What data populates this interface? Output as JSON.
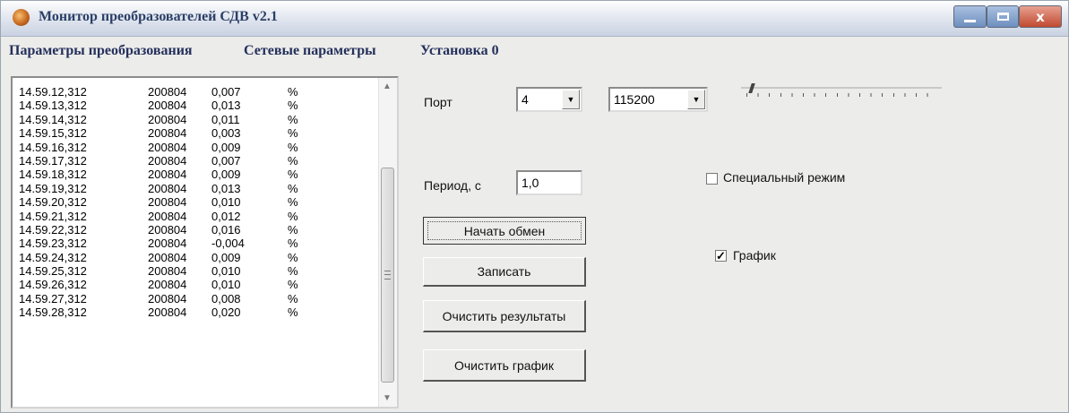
{
  "window": {
    "title": "Монитор преобразователей СДВ v2.1",
    "close_glyph": "x"
  },
  "menu": [
    "Параметры преобразования",
    "Сетевые параметры",
    "Установка 0"
  ],
  "log": {
    "rows": [
      {
        "time": "14.59.12,312",
        "code": "200804",
        "value": "0,007",
        "unit": "%"
      },
      {
        "time": "14.59.13,312",
        "code": "200804",
        "value": "0,013",
        "unit": "%"
      },
      {
        "time": "14.59.14,312",
        "code": "200804",
        "value": "0,011",
        "unit": "%"
      },
      {
        "time": "14.59.15,312",
        "code": "200804",
        "value": "0,003",
        "unit": "%"
      },
      {
        "time": "14.59.16,312",
        "code": "200804",
        "value": "0,009",
        "unit": "%"
      },
      {
        "time": "14.59.17,312",
        "code": "200804",
        "value": "0,007",
        "unit": "%"
      },
      {
        "time": "14.59.18,312",
        "code": "200804",
        "value": "0,009",
        "unit": "%"
      },
      {
        "time": "14.59.19,312",
        "code": "200804",
        "value": "0,013",
        "unit": "%"
      },
      {
        "time": "14.59.20,312",
        "code": "200804",
        "value": "0,010",
        "unit": "%"
      },
      {
        "time": "14.59.21,312",
        "code": "200804",
        "value": "0,012",
        "unit": "%"
      },
      {
        "time": "14.59.22,312",
        "code": "200804",
        "value": "0,016",
        "unit": "%"
      },
      {
        "time": "14.59.23,312",
        "code": "200804",
        "value": "-0,004",
        "unit": "%"
      },
      {
        "time": "14.59.24,312",
        "code": "200804",
        "value": "0,009",
        "unit": "%"
      },
      {
        "time": "14.59.25,312",
        "code": "200804",
        "value": "0,010",
        "unit": "%"
      },
      {
        "time": "14.59.26,312",
        "code": "200804",
        "value": "0,010",
        "unit": "%"
      },
      {
        "time": "14.59.27,312",
        "code": "200804",
        "value": "0,008",
        "unit": "%"
      },
      {
        "time": "14.59.28,312",
        "code": "200804",
        "value": "0,020",
        "unit": "%"
      }
    ]
  },
  "port": {
    "label": "Порт",
    "number": "4",
    "baud": "115200"
  },
  "period": {
    "label": "Период, с",
    "value": "1,0"
  },
  "buttons": {
    "start": "Начать обмен",
    "write": "Записать",
    "clear_results": "Очистить результаты",
    "clear_chart": "Очистить график"
  },
  "options": {
    "special_mode": {
      "label": "Специальный режим",
      "checked": false
    },
    "chart": {
      "label": "График",
      "checked": true
    }
  }
}
